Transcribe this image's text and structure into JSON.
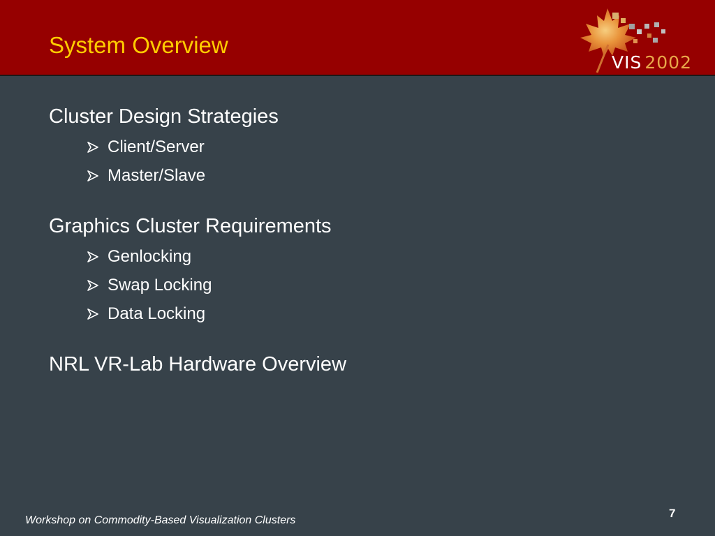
{
  "header": {
    "title": "System Overview",
    "logo": {
      "icon": "maple-leaf-icon",
      "text_main": "VIS",
      "text_year": "2002"
    }
  },
  "sections": [
    {
      "heading": "Cluster Design Strategies",
      "bullets": [
        "Client/Server",
        "Master/Slave"
      ]
    },
    {
      "heading": "Graphics Cluster Requirements",
      "bullets": [
        "Genlocking",
        "Swap Locking",
        "Data Locking"
      ]
    },
    {
      "heading": "NRL VR-Lab Hardware Overview",
      "bullets": []
    }
  ],
  "footer": {
    "text": "Workshop on Commodity-Based Visualization Clusters",
    "page_number": "7"
  },
  "colors": {
    "header_bg": "#960000",
    "body_bg": "#37424a",
    "title": "#ffcc00",
    "text": "#ffffff"
  }
}
